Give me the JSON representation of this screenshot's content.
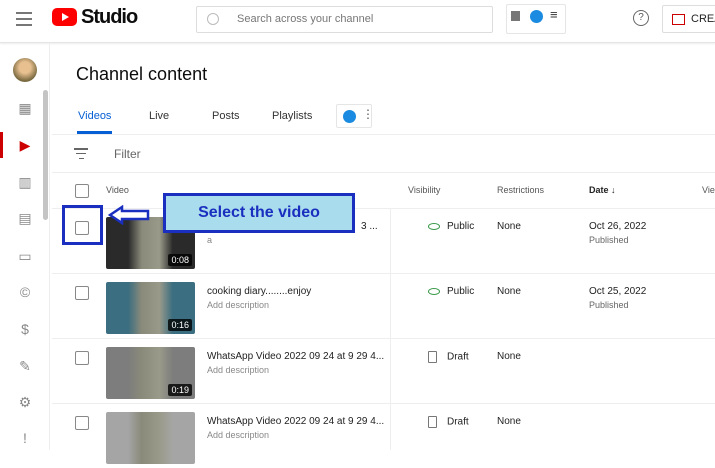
{
  "header": {
    "logo_text": "Studio",
    "search_placeholder": "Search across your channel",
    "help": "?",
    "create_label": "CREA"
  },
  "page": {
    "title": "Channel content",
    "tabs": [
      "Videos",
      "Live",
      "Posts",
      "Playlists"
    ],
    "filter_label": "Filter"
  },
  "table": {
    "headers": {
      "video": "Video",
      "visibility": "Visibility",
      "restrictions": "Restrictions",
      "date": "Date ↓",
      "views": "Vie"
    },
    "rows": [
      {
        "title": "3 ...",
        "description": "a",
        "duration": "0:08",
        "visibility": "Public",
        "restrictions": "None",
        "date": "Oct 26, 2022",
        "status": "Published",
        "thumb": "#2a2a2a"
      },
      {
        "title": "cooking diary........enjoy",
        "description": "Add description",
        "duration": "0:16",
        "visibility": "Public",
        "restrictions": "None",
        "date": "Oct 25, 2022",
        "status": "Published",
        "thumb": "#3b6e80"
      },
      {
        "title": "WhatsApp Video 2022 09 24 at 9 29 4...",
        "description": "Add description",
        "duration": "0:19",
        "visibility": "Draft",
        "restrictions": "None",
        "date": "",
        "status": "",
        "thumb": "#7d7d7d"
      },
      {
        "title": "WhatsApp Video 2022 09 24 at 9 29 4...",
        "description": "Add description",
        "duration": "",
        "visibility": "Draft",
        "restrictions": "None",
        "date": "",
        "status": "",
        "thumb": "#a5a5a5"
      }
    ]
  },
  "annotation": {
    "callout": "Select the video",
    "color": "#1a2fbf"
  }
}
